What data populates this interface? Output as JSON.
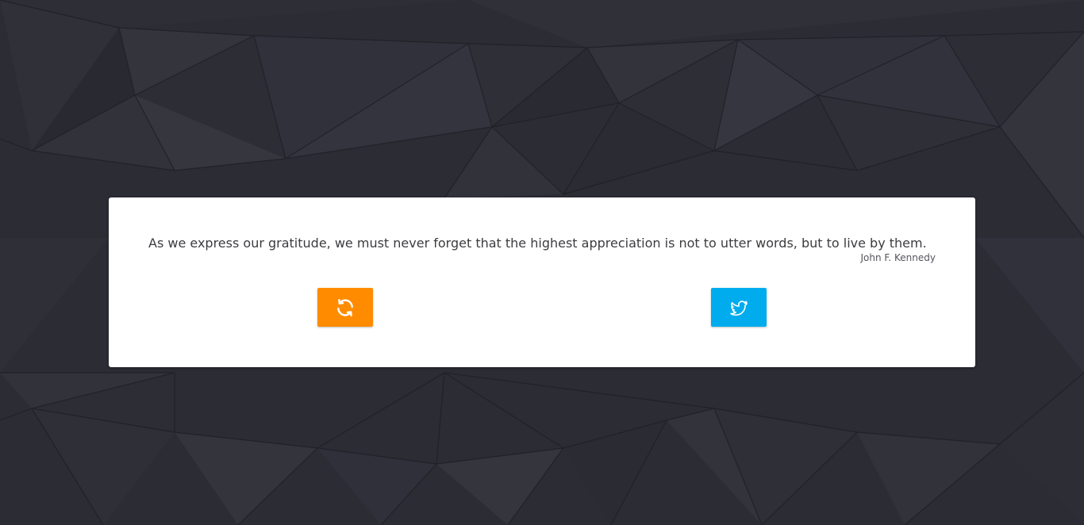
{
  "quote": {
    "text": "As we express our gratitude, we must never forget that the highest appreciation is not to utter words, but to live by them.",
    "author": "John F. Kennedy"
  },
  "buttons": {
    "new_quote": {
      "icon": "refresh-icon",
      "color": "#ff8c00"
    },
    "tweet": {
      "icon": "twitter-icon",
      "color": "#00acee"
    }
  },
  "colors": {
    "background": "#2b2c34",
    "card": "#ffffff",
    "text": "#3c3c40"
  }
}
